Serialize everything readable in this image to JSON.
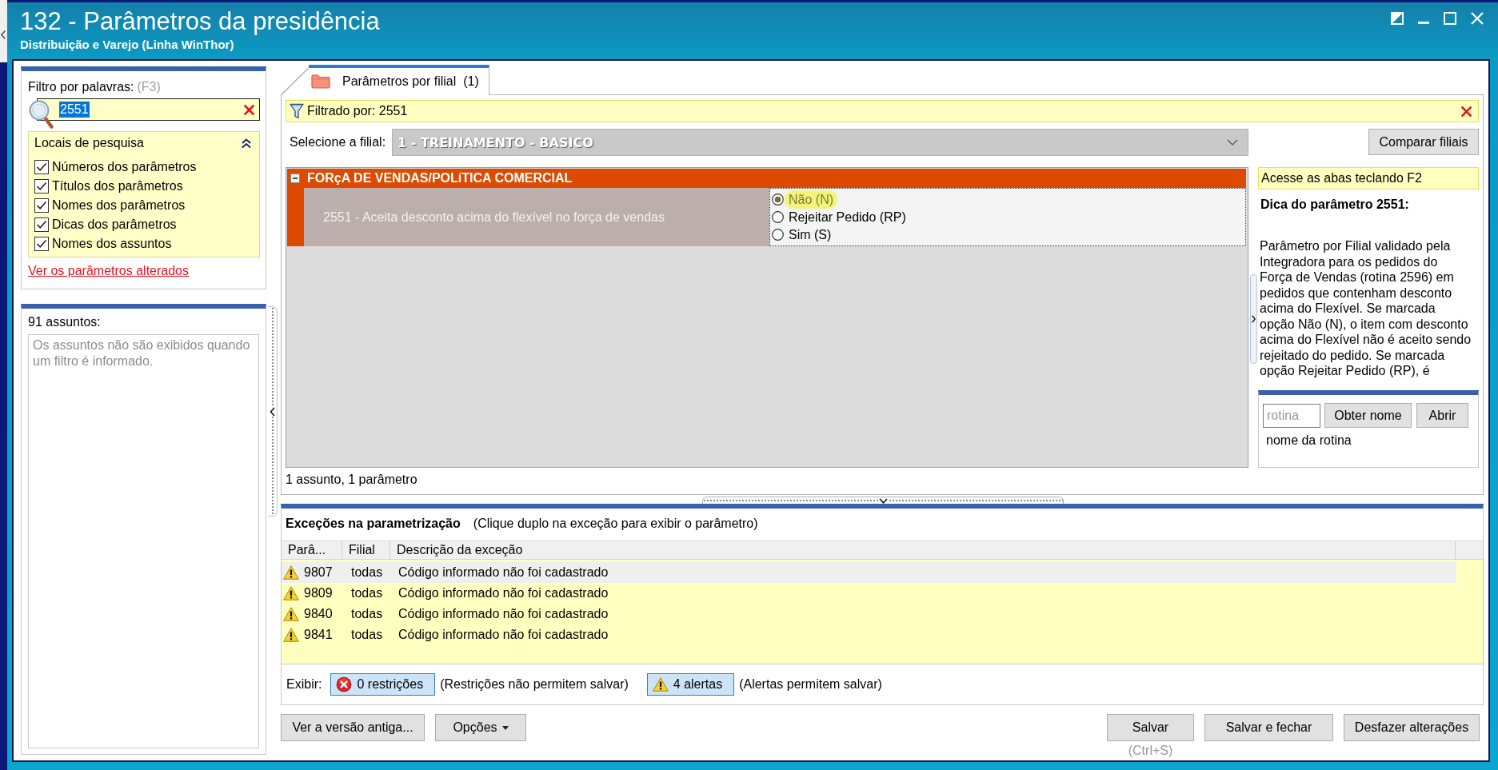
{
  "window": {
    "title": "132 - Parâmetros da presidência",
    "subtitle": "Distribuição e Varejo (Linha WinThor)"
  },
  "filter_panel": {
    "label": "Filtro por palavras:",
    "shortcut": "(F3)",
    "search": {
      "value": "2551",
      "text_selected": true
    },
    "search_locations": {
      "title": "Locais de pesquisa",
      "expanded": true,
      "options": [
        {
          "label": "Números dos parâmetros",
          "checked": true
        },
        {
          "label": "Títulos dos parâmetros",
          "checked": true
        },
        {
          "label": "Nomes dos parâmetros",
          "checked": true
        },
        {
          "label": "Dicas dos parâmetros",
          "checked": true
        },
        {
          "label": "Nomes dos assuntos",
          "checked": true
        }
      ]
    },
    "changed_link": "Ver os parâmetros alterados"
  },
  "subjects_panel": {
    "count_label": "91 assuntos:",
    "empty_message": "Os assuntos não são exibidos quando um filtro é informado."
  },
  "tabs": [
    {
      "label": "Parâmetros por filial",
      "count": "(1)",
      "selected": true
    }
  ],
  "filter_bar": {
    "text": "Filtrado por: 2551"
  },
  "branch_select": {
    "label": "Selecione a filial:",
    "value": "1 - TREINAMENTO - BASICO",
    "disabled": true
  },
  "compare_button": "Comparar filiais",
  "groups": [
    {
      "title": "FORçA DE VENDAS/POLíTICA COMERCIAL",
      "expanded": true,
      "parameters": [
        {
          "label": "2551 - Aceita desconto acima do flexível no força de vendas",
          "options": [
            {
              "label": "Não (N)",
              "selected": true,
              "highlighted": true
            },
            {
              "label": "Rejeitar Pedido (RP)",
              "selected": false,
              "highlighted": false
            },
            {
              "label": "Sim (S)",
              "selected": false,
              "highlighted": false
            }
          ]
        }
      ]
    }
  ],
  "grid_status": "1 assunto, 1 parâmetro",
  "hint_panel": {
    "banner": "Acesse as abas teclando F2",
    "title": "Dica do parâmetro 2551:",
    "text": "Parâmetro por Filial validado pela Integradora para os pedidos do Força de Vendas (rotina 2596) em pedidos que contenham desconto acima do Flexível. Se marcada opção Não (N), o item com desconto acima do Flexível não é aceito sendo rejeitado do pedido. Se marcada opção Rejeitar Pedido (RP), é"
  },
  "routine_lookup": {
    "placeholder": "rotina",
    "buttons": [
      "Obter nome",
      "Abrir"
    ],
    "result": "nome da rotina"
  },
  "exceptions": {
    "title": "Exceções na parametrização",
    "hint": "(Clique duplo na exceção para exibir o parâmetro)",
    "columns": [
      "Parâ...",
      "Filial",
      "Descrição da exceção"
    ],
    "rows": [
      {
        "parameter": "9807",
        "branch": "todas",
        "description": "Código informado não foi cadastrado",
        "selected": true
      },
      {
        "parameter": "9809",
        "branch": "todas",
        "description": "Código informado não foi cadastrado",
        "selected": false
      },
      {
        "parameter": "9840",
        "branch": "todas",
        "description": "Código informado não foi cadastrado",
        "selected": false
      },
      {
        "parameter": "9841",
        "branch": "todas",
        "description": "Código informado não foi cadastrado",
        "selected": false
      }
    ],
    "show_label": "Exibir:",
    "toggles": [
      {
        "kind": "error",
        "label": "0 restrições",
        "note": "(Restrições não permitem salvar)",
        "pressed": true
      },
      {
        "kind": "warning",
        "label": "4 alertas",
        "note": "(Alertas permitem salvar)",
        "pressed": true
      }
    ]
  },
  "footer": {
    "left_buttons": [
      {
        "label": "Ver a versão antiga...",
        "menu": false
      },
      {
        "label": "Opções",
        "menu": true
      }
    ],
    "right_buttons": [
      {
        "label": "Salvar",
        "shortcut": "(Ctrl+S)"
      },
      {
        "label": "Salvar e fechar"
      },
      {
        "label": "Desfazer alterações"
      }
    ]
  }
}
